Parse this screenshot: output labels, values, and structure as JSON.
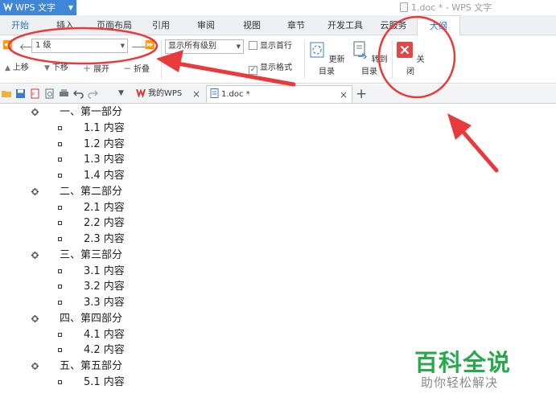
{
  "titlebar": {
    "app_name": "WPS 文字",
    "window_title": "1.doc * - WPS 文字"
  },
  "tabs": [
    "开始",
    "插入",
    "页面布局",
    "引用",
    "审阅",
    "视图",
    "章节",
    "开发工具",
    "云服务",
    "大纲"
  ],
  "active_tab": "大纲",
  "ribbon": {
    "level_value": "1 级",
    "show_level_value": "显示所有级别",
    "show_first_line_label": "显示首行",
    "show_first_line_checked": false,
    "show_format_label": "显示格式",
    "show_format_checked": true,
    "move_up_label": "上移",
    "move_down_label": "下移",
    "expand_label": "展开",
    "collapse_label": "折叠",
    "update_toc_label": "更新目录",
    "goto_toc_label": "转到目录",
    "close_label": "关闭"
  },
  "doc_tabs": [
    {
      "label": "我的WPS",
      "active": false
    },
    {
      "label": "1.doc *",
      "active": true
    }
  ],
  "outline": [
    {
      "level": 1,
      "text": "一、第一部分"
    },
    {
      "level": 2,
      "text": "1.1 内容"
    },
    {
      "level": 2,
      "text": "1.2 内容"
    },
    {
      "level": 2,
      "text": "1.3 内容"
    },
    {
      "level": 2,
      "text": "1.4 内容"
    },
    {
      "level": 1,
      "text": "二、第二部分"
    },
    {
      "level": 2,
      "text": "2.1 内容"
    },
    {
      "level": 2,
      "text": "2.2 内容"
    },
    {
      "level": 2,
      "text": "2.3 内容"
    },
    {
      "level": 1,
      "text": "三、第三部分"
    },
    {
      "level": 2,
      "text": "3.1 内容"
    },
    {
      "level": 2,
      "text": "3.2 内容"
    },
    {
      "level": 2,
      "text": "3.3 内容"
    },
    {
      "level": 1,
      "text": "四、第四部分"
    },
    {
      "level": 2,
      "text": "4.1 内容"
    },
    {
      "level": 2,
      "text": "4.2 内容"
    },
    {
      "level": 1,
      "text": "五、第五部分"
    },
    {
      "level": 2,
      "text": "5.1 内容"
    }
  ],
  "watermark": {
    "title": "百科全说",
    "subtitle": "助你轻松解决"
  },
  "colors": {
    "accent_blue": "#3f86d6",
    "annotation_red": "#e83a3a",
    "close_red": "#e04848",
    "watermark_green": "#27a84a"
  }
}
